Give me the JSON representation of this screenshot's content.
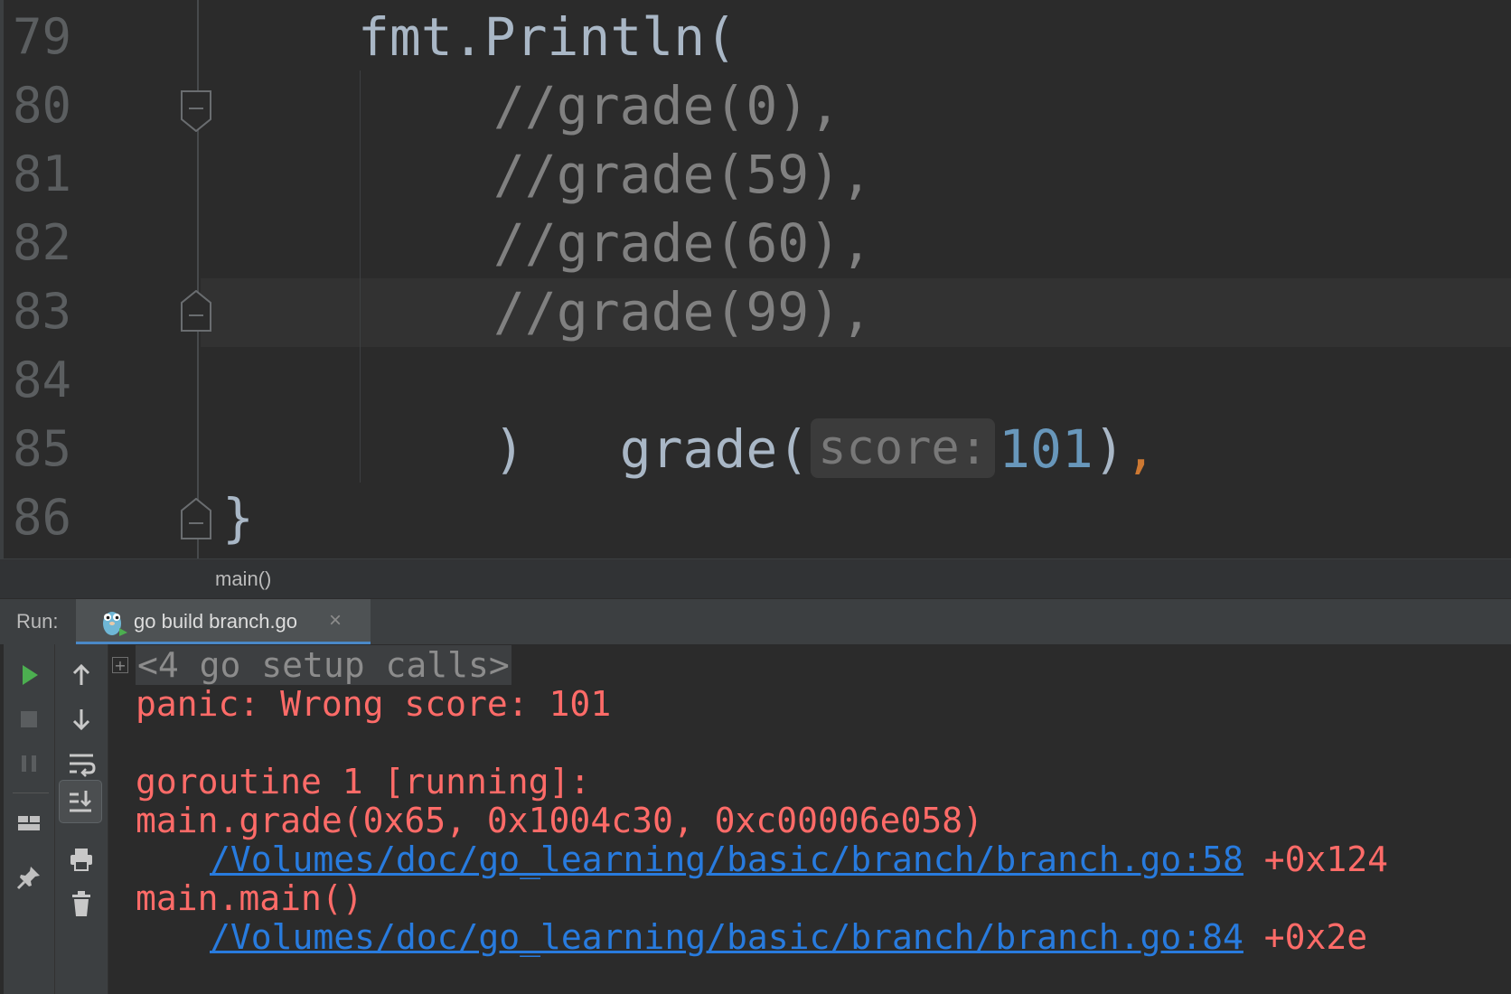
{
  "editor": {
    "lines": [
      {
        "num": "79",
        "code": "fmt.Println("
      },
      {
        "num": "80",
        "code": "//grade(0),"
      },
      {
        "num": "81",
        "code": "//grade(59),"
      },
      {
        "num": "82",
        "code": "//grade(60),"
      },
      {
        "num": "83",
        "code": "//grade(99),"
      },
      {
        "num": "84",
        "code_prefix": "grade(",
        "hint": "score:",
        "arg": "101",
        "close": ")",
        "comma": ","
      },
      {
        "num": "85",
        "code": ")"
      },
      {
        "num": "86",
        "code": "}"
      }
    ],
    "breadcrumb": "main()"
  },
  "run": {
    "label": "Run:",
    "tab_label": "go build branch.go",
    "tab_close": "×",
    "console": {
      "expand": "+",
      "setup": "<4 go setup calls>",
      "panic": "panic: Wrong score: 101",
      "goroutine": "goroutine 1 [running]:",
      "frame1_func": "main.grade(0x65, 0x1004c30, 0xc00006e058)",
      "frame1_link": "/Volumes/doc/go_learning/basic/branch/branch.go:58",
      "frame1_offset": " +0x124",
      "frame2_func": "main.main()",
      "frame2_link": "/Volumes/doc/go_learning/basic/branch/branch.go:84",
      "frame2_offset": " +0x2e"
    }
  },
  "colors": {
    "background": "#2b2b2b",
    "error_text": "#ff6b68",
    "link": "#287bde",
    "comment": "#808080",
    "number": "#6897bb",
    "keyword_comma": "#cc7832",
    "run_green": "#4caf50"
  },
  "icons": {
    "toolbar_left": [
      "run-icon",
      "stop-icon",
      "pause-icon",
      "layout-icon",
      "pin-icon"
    ],
    "toolbar_right": [
      "arrow-up-icon",
      "arrow-down-icon",
      "soft-wrap-icon",
      "scroll-to-end-icon",
      "print-icon",
      "trash-icon"
    ],
    "tab": "gopher-icon"
  }
}
